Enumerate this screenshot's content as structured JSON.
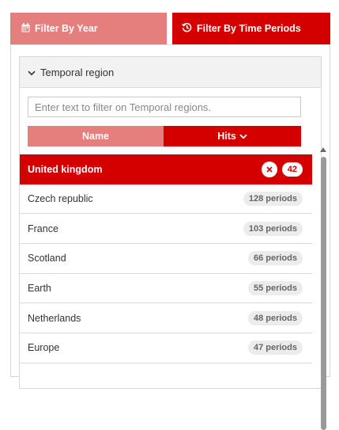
{
  "tabs": {
    "year_label": "Filter By Year",
    "time_label": "Filter By Time Periods"
  },
  "section": {
    "title": "Temporal region"
  },
  "filter": {
    "placeholder": "Enter text to filter on Temporal regions."
  },
  "sort": {
    "name_label": "Name",
    "hits_label": "Hits"
  },
  "list": {
    "selected": {
      "name": "United kingdom",
      "count": "42"
    },
    "items": [
      {
        "name": "Czech republic",
        "count": "128 periods"
      },
      {
        "name": "France",
        "count": "103 periods"
      },
      {
        "name": "Scotland",
        "count": "66 periods"
      },
      {
        "name": "Earth",
        "count": "55 periods"
      },
      {
        "name": "Netherlands",
        "count": "48 periods"
      },
      {
        "name": "Europe",
        "count": "47 periods"
      }
    ]
  },
  "colors": {
    "accent": "#d40000",
    "accent_light": "#e57f7e"
  }
}
